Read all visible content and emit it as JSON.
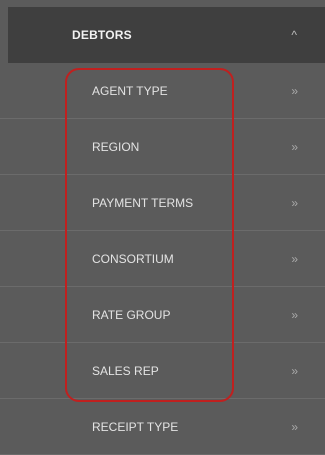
{
  "menu": {
    "header": {
      "label": "DEBTORS",
      "caret_glyph": "^",
      "icon": "chevron-up-icon"
    },
    "items": [
      {
        "label": "AGENT TYPE",
        "chevron": "»"
      },
      {
        "label": "REGION",
        "chevron": "»"
      },
      {
        "label": "PAYMENT TERMS",
        "chevron": "»"
      },
      {
        "label": "CONSORTIUM",
        "chevron": "»"
      },
      {
        "label": "RATE GROUP",
        "chevron": "»"
      },
      {
        "label": "SALES REP",
        "chevron": "»"
      },
      {
        "label": "RECEIPT TYPE",
        "chevron": "»"
      }
    ]
  },
  "colors": {
    "menu_bg": "#5b5b5b",
    "header_bg": "#3f3f3f",
    "highlight": "#c0201f"
  }
}
